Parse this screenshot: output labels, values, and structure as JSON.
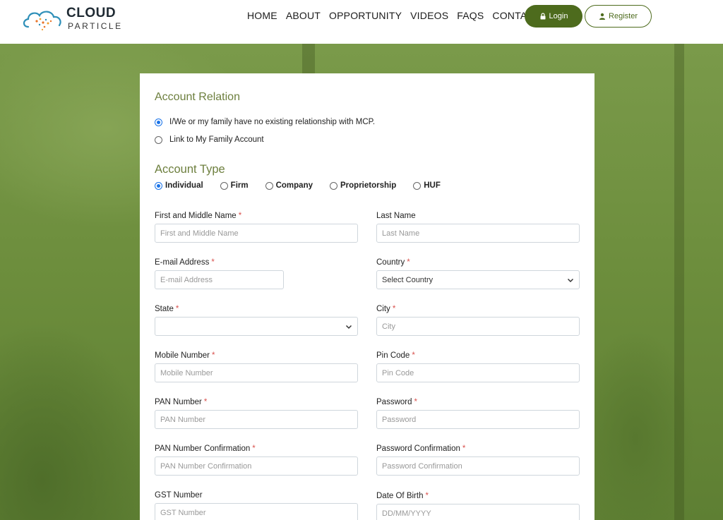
{
  "brand": {
    "main": "CLOUD",
    "sub": "PARTICLE"
  },
  "nav": [
    {
      "label": "HOME"
    },
    {
      "label": "ABOUT"
    },
    {
      "label": "OPPORTUNITY"
    },
    {
      "label": "VIDEOS"
    },
    {
      "label": "FAQS"
    },
    {
      "label": "CONTACTUS"
    }
  ],
  "buttons": {
    "login": "Login",
    "register": "Register"
  },
  "colors": {
    "accent": "#4d6b1d",
    "section_title": "#6d7f3e",
    "required": "#d9534f"
  },
  "account_relation": {
    "title": "Account Relation",
    "options": [
      {
        "label": "I/We or my family have no existing relationship with MCP.",
        "selected": true
      },
      {
        "label": "Link to My Family Account",
        "selected": false
      }
    ]
  },
  "account_type": {
    "title": "Account Type",
    "options": [
      {
        "label": "Individual",
        "selected": true
      },
      {
        "label": "Firm",
        "selected": false
      },
      {
        "label": "Company",
        "selected": false
      },
      {
        "label": "Proprietorship",
        "selected": false
      },
      {
        "label": "HUF",
        "selected": false
      }
    ]
  },
  "form": {
    "first_middle_name": {
      "label": "First and Middle Name",
      "placeholder": "First and Middle Name"
    },
    "last_name": {
      "label": "Last Name",
      "placeholder": "Last Name"
    },
    "email": {
      "label": "E-mail Address",
      "placeholder": "E-mail Address"
    },
    "country": {
      "label": "Country",
      "value": "Select Country"
    },
    "state": {
      "label": "State",
      "value": ""
    },
    "city": {
      "label": "City",
      "placeholder": "City"
    },
    "mobile": {
      "label": "Mobile Number",
      "placeholder": "Mobile Number"
    },
    "pin": {
      "label": "Pin Code",
      "placeholder": "Pin Code"
    },
    "pan": {
      "label": "PAN Number",
      "placeholder": "PAN Number"
    },
    "password": {
      "label": "Password",
      "placeholder": "Password"
    },
    "pan_confirm": {
      "label": "PAN Number Confirmation",
      "placeholder": "PAN Number Confirmation"
    },
    "password_confirm": {
      "label": "Password Confirmation",
      "placeholder": "Password Confirmation"
    },
    "gst": {
      "label": "GST Number",
      "placeholder": "GST Number"
    },
    "dob": {
      "label": "Date Of Birth",
      "placeholder": "DD/MM/YYYY"
    },
    "required_mark": "*"
  }
}
